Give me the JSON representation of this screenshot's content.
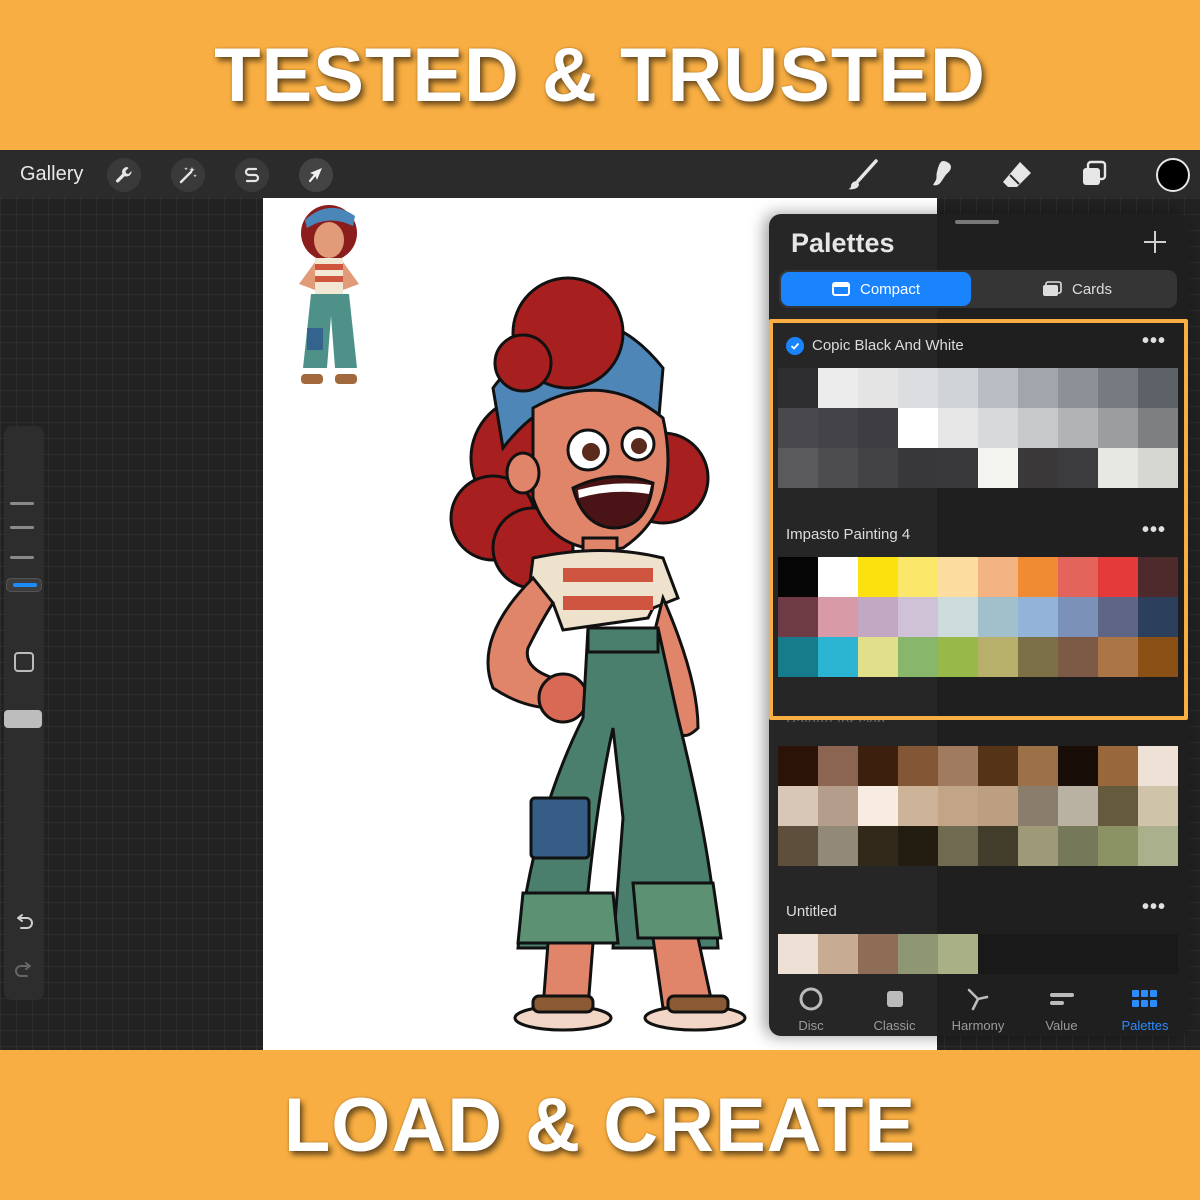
{
  "banner": {
    "top": "TESTED & TRUSTED",
    "bottom": "LOAD & CREATE",
    "color": "#F8AE42"
  },
  "toolbar": {
    "gallery_label": "Gallery",
    "left_icons": [
      "wrench-icon",
      "magic-wand-icon",
      "selection-s-icon",
      "transform-arrow-icon"
    ],
    "right_icons": [
      "brush-icon",
      "smudge-icon",
      "eraser-icon",
      "layers-icon"
    ],
    "current_color": "#000000"
  },
  "palettes_panel": {
    "title": "Palettes",
    "view_tabs": {
      "compact": "Compact",
      "cards": "Cards",
      "selected": "compact"
    },
    "palettes": [
      {
        "name": "Copic Black And White",
        "is_default": true,
        "swatches": [
          "#2e2e30",
          "#ececec",
          "#e4e4e4",
          "#dcdde0",
          "#d0d3d8",
          "#b9bec4",
          "#a1a6ad",
          "#8c9198",
          "#767a81",
          "#5d6168",
          "#48484d",
          "#434348",
          "#3e3d42",
          "#ffffff",
          "#e6e6e6",
          "#d8d9da",
          "#c7c8ca",
          "#b2b3b5",
          "#9c9d9f",
          "#7e7f81",
          "#5a5a5c",
          "#4d4d50",
          "#434346",
          "#38383b",
          "#39383b",
          "#f4f4f1",
          "#3a3839",
          "#3c3b3d",
          "#e7e7e3",
          "#d6d6d3"
        ]
      },
      {
        "name": "Impasto Painting 4",
        "is_default": false,
        "swatches": [
          "#050505",
          "#ffffff",
          "#fde10e",
          "#fbe86a",
          "#fddca0",
          "#f4b383",
          "#f08a33",
          "#e2645a",
          "#e53a3a",
          "#4e2a2c",
          "#6e3a44",
          "#d99aa8",
          "#c3a8c4",
          "#d0c2d6",
          "#cbdcda",
          "#a2c0cc",
          "#93b3d9",
          "#7b91b8",
          "#5e6586",
          "#2c3f5c",
          "#167c8c",
          "#2bb5d3",
          "#e0e08a",
          "#88b66a",
          "#98b94a",
          "#b7b06a",
          "#7c7046",
          "#7d5a45",
          "#ab7548",
          "#8b5016"
        ]
      },
      {
        "name": "Palette for skin",
        "is_default": false,
        "swatches": [
          "#2b1308",
          "#8b6551",
          "#3d1f0d",
          "#835636",
          "#a17b60",
          "#543317",
          "#9c7148",
          "#190d07",
          "#98673c",
          "#eee2d6",
          "#d8c6b6",
          "#b49e8b",
          "#f8ebe2",
          "#cdb397",
          "#c2a587",
          "#bc9e81",
          "#8b7d6c",
          "#b9b1a2",
          "#665a3e",
          "#cfc3aa",
          "#5d4f3b",
          "#928978",
          "#33291b",
          "#231c10",
          "#6f6a50",
          "#413d2a",
          "#9e9a78",
          "#76785a",
          "#8b9365",
          "#a9b08b"
        ]
      },
      {
        "name": "Untitled",
        "is_default": false,
        "swatches": [
          "#ede1d6",
          "#c7ac93",
          "#8f6c55",
          "#8e9673",
          "#a9b085"
        ]
      }
    ],
    "bottom_tabs": [
      {
        "label": "Disc",
        "icon": "disc-icon",
        "active": false
      },
      {
        "label": "Classic",
        "icon": "classic-square-icon",
        "active": false
      },
      {
        "label": "Harmony",
        "icon": "harmony-icon",
        "active": false
      },
      {
        "label": "Value",
        "icon": "value-sliders-icon",
        "active": false
      },
      {
        "label": "Palettes",
        "icon": "palettes-grid-icon",
        "active": true
      }
    ],
    "accent_color": "#1a84ff"
  }
}
